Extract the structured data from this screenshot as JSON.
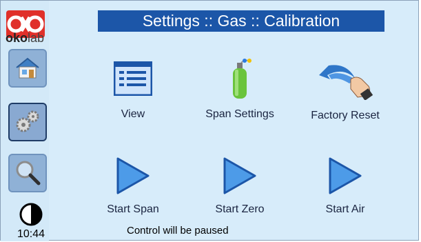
{
  "header": {
    "title": "Settings :: Gas :: Calibration"
  },
  "logo": {
    "brand_bold": "oko",
    "brand_light": "lab"
  },
  "sidebar": {
    "items": [
      {
        "name": "home",
        "icon": "home-icon"
      },
      {
        "name": "settings",
        "icon": "gears-icon",
        "active": true
      },
      {
        "name": "search",
        "icon": "magnifier-icon"
      }
    ],
    "clock": {
      "time": "10:44"
    }
  },
  "actions": {
    "view": "View",
    "span_settings": "Span Settings",
    "factory_reset": "Factory Reset",
    "start_span": "Start Span",
    "start_zero": "Start Zero",
    "start_air": "Start Air"
  },
  "footer": {
    "note": "Control will be paused"
  },
  "colors": {
    "title_bar": "#1c56a8",
    "background": "#d7ecfa",
    "button": "#8fb1d6",
    "logo_red": "#e0302a"
  }
}
